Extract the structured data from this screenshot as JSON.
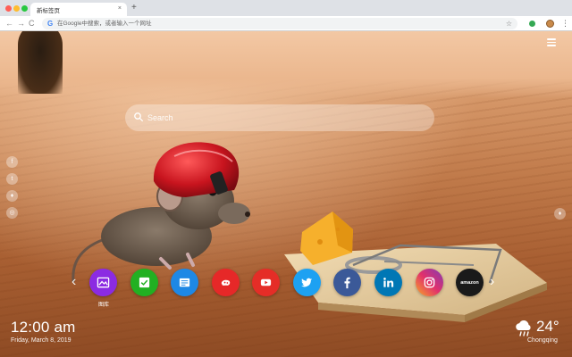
{
  "browser": {
    "tab_title": "新标签页",
    "tab_close": "×",
    "new_tab": "+",
    "omnibox_placeholder": "在Google中搜索，或者输入一个网址",
    "back": "←",
    "forward": "→",
    "reload": "C",
    "kebab": "⋮"
  },
  "search": {
    "placeholder": "Search"
  },
  "social_left": [
    {
      "name": "facebook-icon",
      "glyph": "f"
    },
    {
      "name": "twitter-icon",
      "glyph": "t"
    },
    {
      "name": "fire-icon",
      "glyph": "♦"
    },
    {
      "name": "chat-icon",
      "glyph": "◎"
    }
  ],
  "quick_links": [
    {
      "name": "gallery-link",
      "icon": "image-icon",
      "color": "#8b2be2",
      "label": "图库"
    },
    {
      "name": "check-link",
      "icon": "check-icon",
      "color": "#22b022"
    },
    {
      "name": "notes-link",
      "icon": "note-icon",
      "color": "#1e88e5"
    },
    {
      "name": "game-link",
      "icon": "gamepad-icon",
      "color": "#e62828"
    },
    {
      "name": "youtube-link",
      "icon": "youtube-icon",
      "color": "#e52d27"
    },
    {
      "name": "twitter-link",
      "icon": "twitter-icon",
      "color": "#1da1f2"
    },
    {
      "name": "facebook-link",
      "icon": "facebook-icon",
      "color": "#3b5998"
    },
    {
      "name": "linkedin-link",
      "icon": "linkedin-icon",
      "color": "#0077b5"
    },
    {
      "name": "instagram-link",
      "icon": "instagram-icon",
      "color": "#c13584"
    },
    {
      "name": "amazon-link",
      "icon": "amazon-icon",
      "color": "#1a1a1a",
      "label_in_icon": "amazon"
    }
  ],
  "nav_arrows": {
    "left": "‹",
    "right": "›"
  },
  "clock": {
    "time": "12:00 am",
    "date": "Friday, March 8, 2019"
  },
  "weather": {
    "temp": "24°",
    "city": "Chongqing",
    "icon": "cloud-rain-icon"
  }
}
